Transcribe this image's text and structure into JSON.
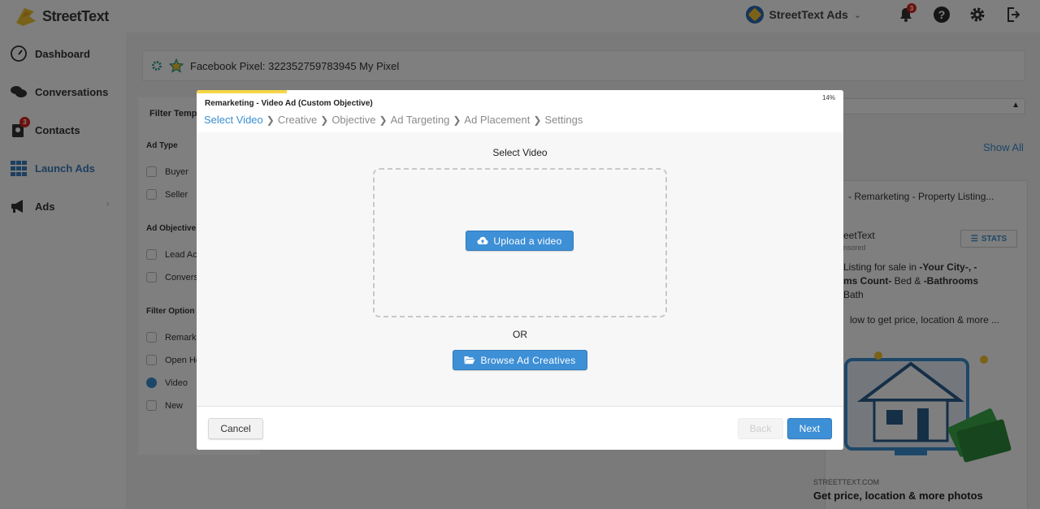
{
  "app": {
    "name": "StreetText"
  },
  "header": {
    "account_name": "StreetText Ads",
    "notification_count": "3"
  },
  "sidebar": {
    "items": [
      {
        "label": "Dashboard",
        "icon": "gauge-icon"
      },
      {
        "label": "Conversations",
        "icon": "chat-icon"
      },
      {
        "label": "Contacts",
        "icon": "contacts-icon",
        "badge": "3"
      },
      {
        "label": "Launch Ads",
        "icon": "grid-icon",
        "active": true
      },
      {
        "label": "Ads",
        "icon": "megaphone-icon"
      }
    ]
  },
  "pixel_bar": {
    "text": "Facebook Pixel: 322352759783945 My Pixel"
  },
  "filter_panel": {
    "filter_label": "Filter Temp",
    "ad_type_heading": "Ad Type",
    "ad_types": [
      "Buyer",
      "Seller"
    ],
    "objective_heading": "Ad Objective",
    "objectives": [
      "Lead Ac",
      "Convers"
    ],
    "options_heading": "Filter Option",
    "options": [
      {
        "label": "Remark",
        "checked": false
      },
      {
        "label": "Open Ho",
        "checked": false
      },
      {
        "label": "Video",
        "checked": true
      },
      {
        "label": "New",
        "checked": false
      }
    ]
  },
  "right_panel": {
    "show_all": "Show All",
    "card_title": "- Remarketing - Property Listing...",
    "page_name": "reetText",
    "sponsored": "nsored",
    "stats_label": "STATS",
    "body_line1": "Listing for sale in ",
    "body_bold1": "-Your City-, -",
    "body_bold2": "ms Count-",
    "body_line2": " Bed & ",
    "body_bold3": "-Bathrooms",
    "body_line3": "Bath",
    "body_line4": "low to get price, location & more ...",
    "domain": "STREETTEXT.COM",
    "headline": "Get price, location & more photos"
  },
  "modal": {
    "progress_percent": 14,
    "progress_label": "14%",
    "title": "Remarketing - Video Ad (Custom Objective)",
    "steps": [
      "Select Video",
      "Creative",
      "Objective",
      "Ad Targeting",
      "Ad Placement",
      "Settings"
    ],
    "active_step": 0,
    "section_label": "Select Video",
    "upload_label": "Upload a video",
    "or_label": "OR",
    "browse_label": "Browse Ad Creatives",
    "cancel_label": "Cancel",
    "back_label": "Back",
    "next_label": "Next"
  },
  "colors": {
    "accent": "#3d8fd6",
    "progress": "#f5d547",
    "badge": "#d9251c"
  }
}
